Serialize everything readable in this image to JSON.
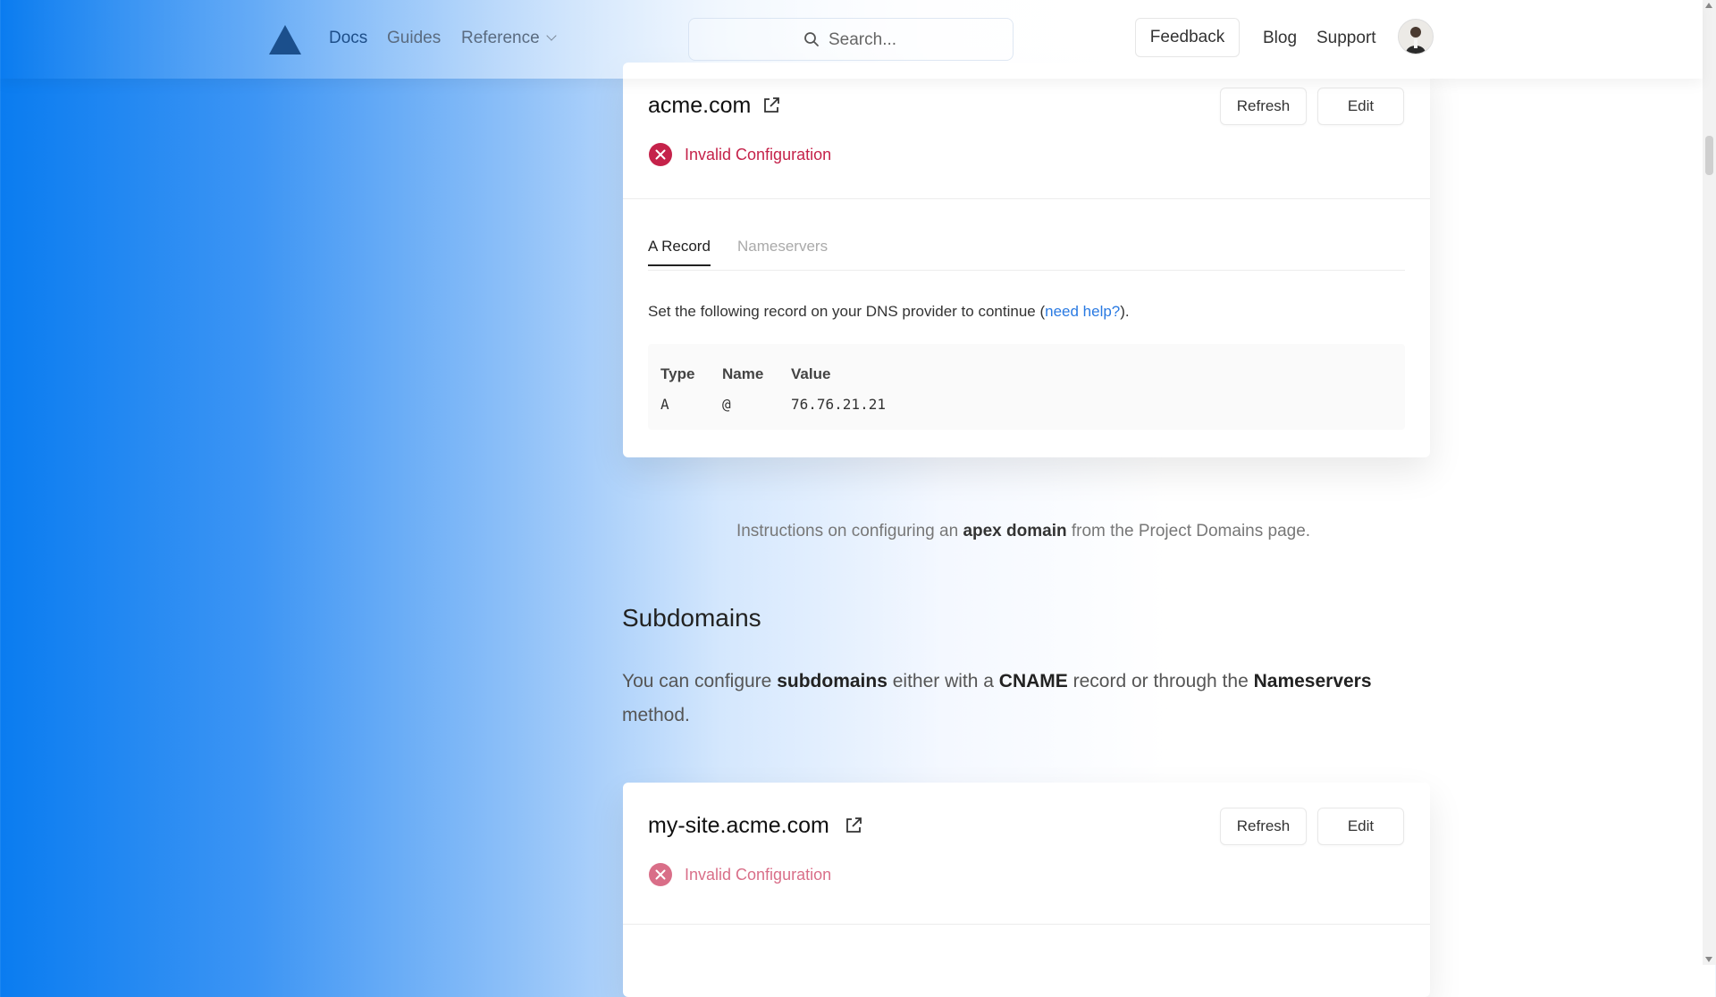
{
  "header": {
    "nav": {
      "docs": "Docs",
      "guides": "Guides",
      "reference": "Reference",
      "blog": "Blog",
      "support": "Support"
    },
    "search_placeholder": "Search...",
    "feedback_label": "Feedback",
    "logo_icon": "triangle-logo-icon",
    "avatar_icon": "user-avatar"
  },
  "card1": {
    "domain": "acme.com",
    "refresh_label": "Refresh",
    "edit_label": "Edit",
    "status": "Invalid Configuration",
    "tabs": [
      {
        "label": "A Record"
      },
      {
        "label": "Nameservers"
      }
    ],
    "instruction_prefix": "Set the following record on your DNS provider to continue (",
    "instruction_link": "need help?",
    "instruction_suffix": ").",
    "table": {
      "headers": [
        "Type",
        "Name",
        "Value"
      ],
      "rows": [
        [
          "A",
          "@",
          "76.76.21.21"
        ]
      ]
    }
  },
  "caption": {
    "prefix": "Instructions on configuring an ",
    "bold": "apex domain",
    "suffix": " from the Project Domains page."
  },
  "subdomains": {
    "heading": "Subdomains",
    "p1": "You can configure ",
    "b1": "subdomains",
    "p2": " either with a ",
    "b2": "CNAME",
    "p3": " record or through the ",
    "b3": "Nameservers",
    "p4": " method."
  },
  "card2": {
    "domain": "my-site.acme.com",
    "refresh_label": "Refresh",
    "edit_label": "Edit",
    "status": "Invalid Configuration"
  },
  "colors": {
    "accent": "#2a7ae2",
    "error": "#c5224a",
    "nav_active": "#1d4e89"
  }
}
